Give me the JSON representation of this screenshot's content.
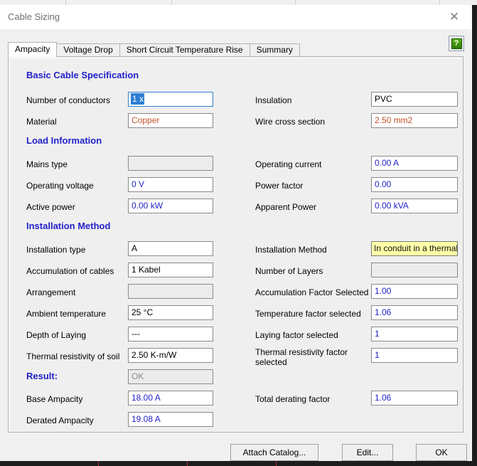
{
  "window": {
    "title": "Cable Sizing",
    "close_label": "✕",
    "help_icon_glyph": "?"
  },
  "tabs": [
    {
      "label": "Ampacity",
      "active": true
    },
    {
      "label": "Voltage Drop",
      "active": false
    },
    {
      "label": "Short Circuit Temperature Rise",
      "active": false
    },
    {
      "label": "Summary",
      "active": false
    }
  ],
  "sections": {
    "basic_cable_specification": "Basic Cable Specification",
    "load_information": "Load Information",
    "installation_method": "Installation Method",
    "result": "Result:"
  },
  "fields": {
    "number_of_conductors": {
      "label": "Number of conductors",
      "value": "1 x"
    },
    "material": {
      "label": "Material",
      "value": "Copper"
    },
    "insulation": {
      "label": "Insulation",
      "value": "PVC"
    },
    "wire_cross_section": {
      "label": "Wire cross section",
      "value": "2.50 mm2"
    },
    "mains_type": {
      "label": "Mains type",
      "value": ""
    },
    "operating_voltage": {
      "label": "Operating voltage",
      "value": "0 V"
    },
    "active_power": {
      "label": "Active power",
      "value": "0.00 kW"
    },
    "operating_current": {
      "label": "Operating current",
      "value": "0.00 A"
    },
    "power_factor": {
      "label": "Power factor",
      "value": "0.00"
    },
    "apparent_power": {
      "label": "Apparent Power",
      "value": "0.00 kVA"
    },
    "installation_type": {
      "label": "Installation type",
      "value": "A"
    },
    "accumulation_of_cables": {
      "label": "Accumulation of cables",
      "value": "1 Kabel"
    },
    "arrangement": {
      "label": "Arrangement",
      "value": ""
    },
    "ambient_temperature": {
      "label": "Ambient temperature",
      "value": "25 °C"
    },
    "depth_of_laying": {
      "label": "Depth of Laying",
      "value": "---"
    },
    "thermal_resistivity_of_soil": {
      "label": "Thermal resistivity of soil",
      "value": "2.50 K-m/W"
    },
    "installation_method_value": {
      "label": "Installation Method",
      "value": "In conduit in a thermal"
    },
    "number_of_layers": {
      "label": "Number of Layers",
      "value": ""
    },
    "accumulation_factor_selected": {
      "label": "Accumulation Factor Selected",
      "value": "1.00"
    },
    "temperature_factor_selected": {
      "label": "Temperature factor selected",
      "value": "1.06"
    },
    "laying_factor_selected": {
      "label": "Laying factor selected",
      "value": "1"
    },
    "thermal_resistivity_factor_selected": {
      "label": "Thermal resistivity factor selected",
      "value": "1"
    },
    "result_status": {
      "label": "Result:",
      "value": "OK"
    },
    "base_ampacity": {
      "label": "Base Ampacity",
      "value": "18.00 A"
    },
    "derated_ampacity": {
      "label": "Derated Ampacity",
      "value": "19.08 A"
    },
    "total_derating_factor": {
      "label": "Total derating factor",
      "value": "1.06"
    }
  },
  "buttons": {
    "attach_catalog": "Attach Catalog...",
    "edit": "Edit...",
    "ok": "OK"
  },
  "colors": {
    "section_heading": "#2222cc",
    "value_blue": "#2222cc",
    "value_brown": "#c0522a",
    "highlight_yellow": "#ffffa8",
    "focus_blue": "#2e7fd4",
    "dialog_bg": "#f0f0f0"
  }
}
